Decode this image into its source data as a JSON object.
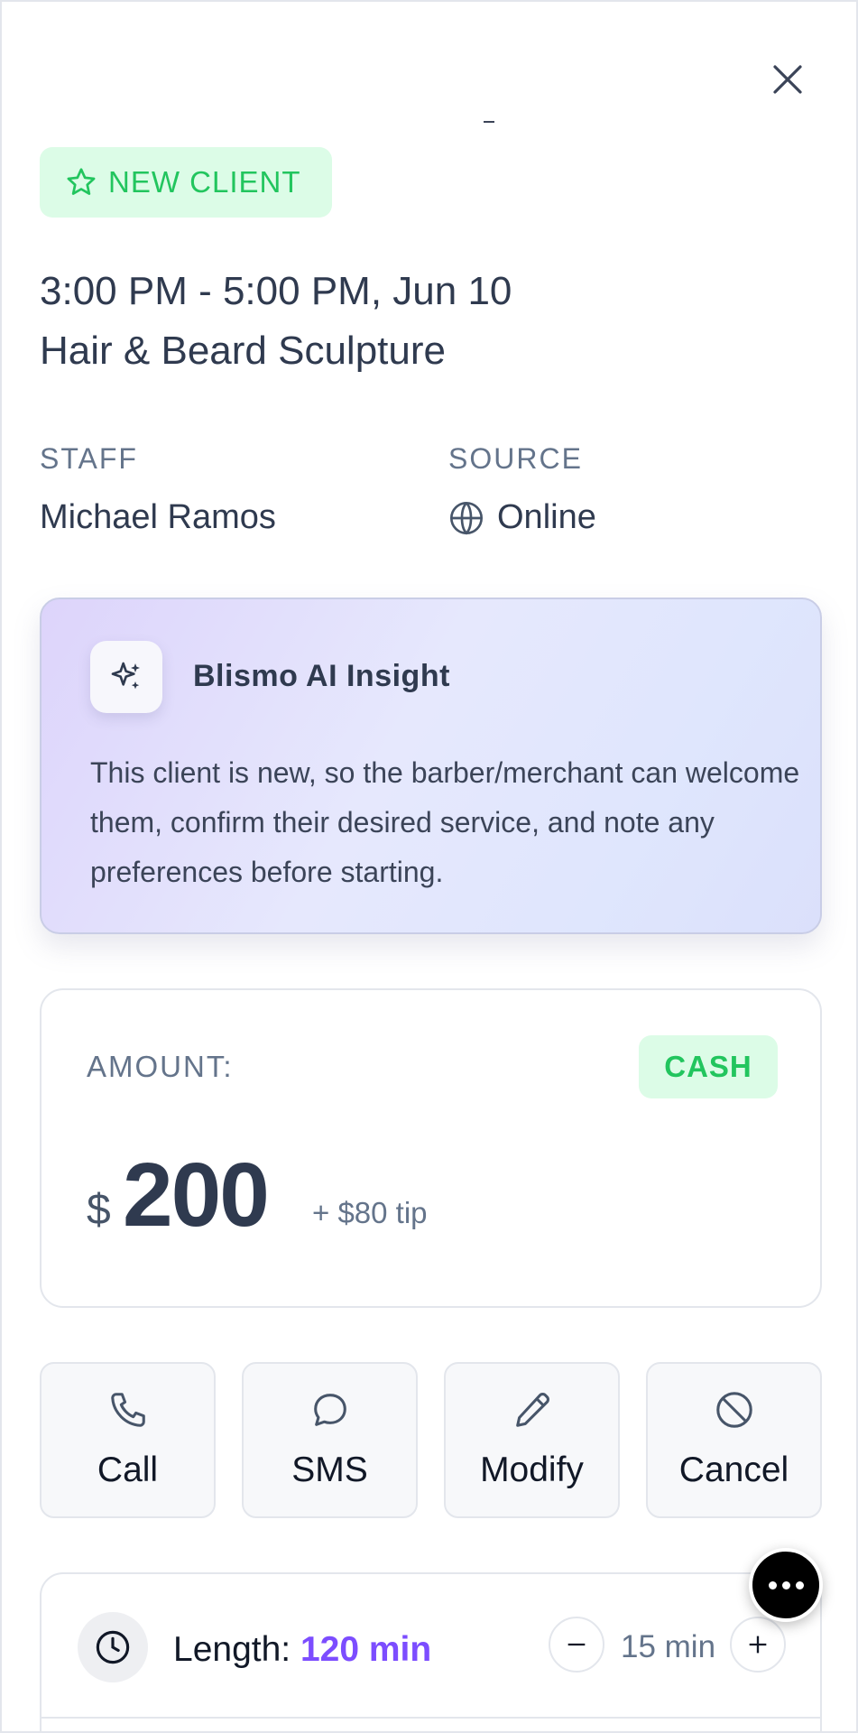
{
  "header": {
    "close_icon": "close-icon"
  },
  "badge": {
    "icon": "star-icon",
    "label": "NEW CLIENT",
    "color": "#22c55e",
    "background": "#dcfce7"
  },
  "appointment": {
    "time": "3:00 PM - 5:00 PM, Jun 10",
    "service": "Hair & Beard Sculpture"
  },
  "details": {
    "staff_label": "STAFF",
    "staff_value": "Michael Ramos",
    "source_label": "SOURCE",
    "source_icon": "globe-icon",
    "source_value": "Online"
  },
  "insight": {
    "icon": "sparkles-icon",
    "title": "Blismo AI Insight",
    "text": "This client is new, so the barber/merchant can welcome them, confirm their desired service, and note any preferences before starting."
  },
  "payment": {
    "label": "AMOUNT:",
    "method": "CASH",
    "currency": "$",
    "amount": "200",
    "tip": "+ $80 tip"
  },
  "actions": [
    {
      "label": "Call",
      "icon": "phone-icon"
    },
    {
      "label": "SMS",
      "icon": "message-icon"
    },
    {
      "label": "Modify",
      "icon": "pencil-icon"
    },
    {
      "label": "Cancel",
      "icon": "ban-icon"
    }
  ],
  "length": {
    "icon": "clock-icon",
    "label": "Length:",
    "value": "120 min",
    "step": "15 min",
    "accent": "#7c4dff"
  },
  "fab": {
    "icon": "more-icon"
  }
}
